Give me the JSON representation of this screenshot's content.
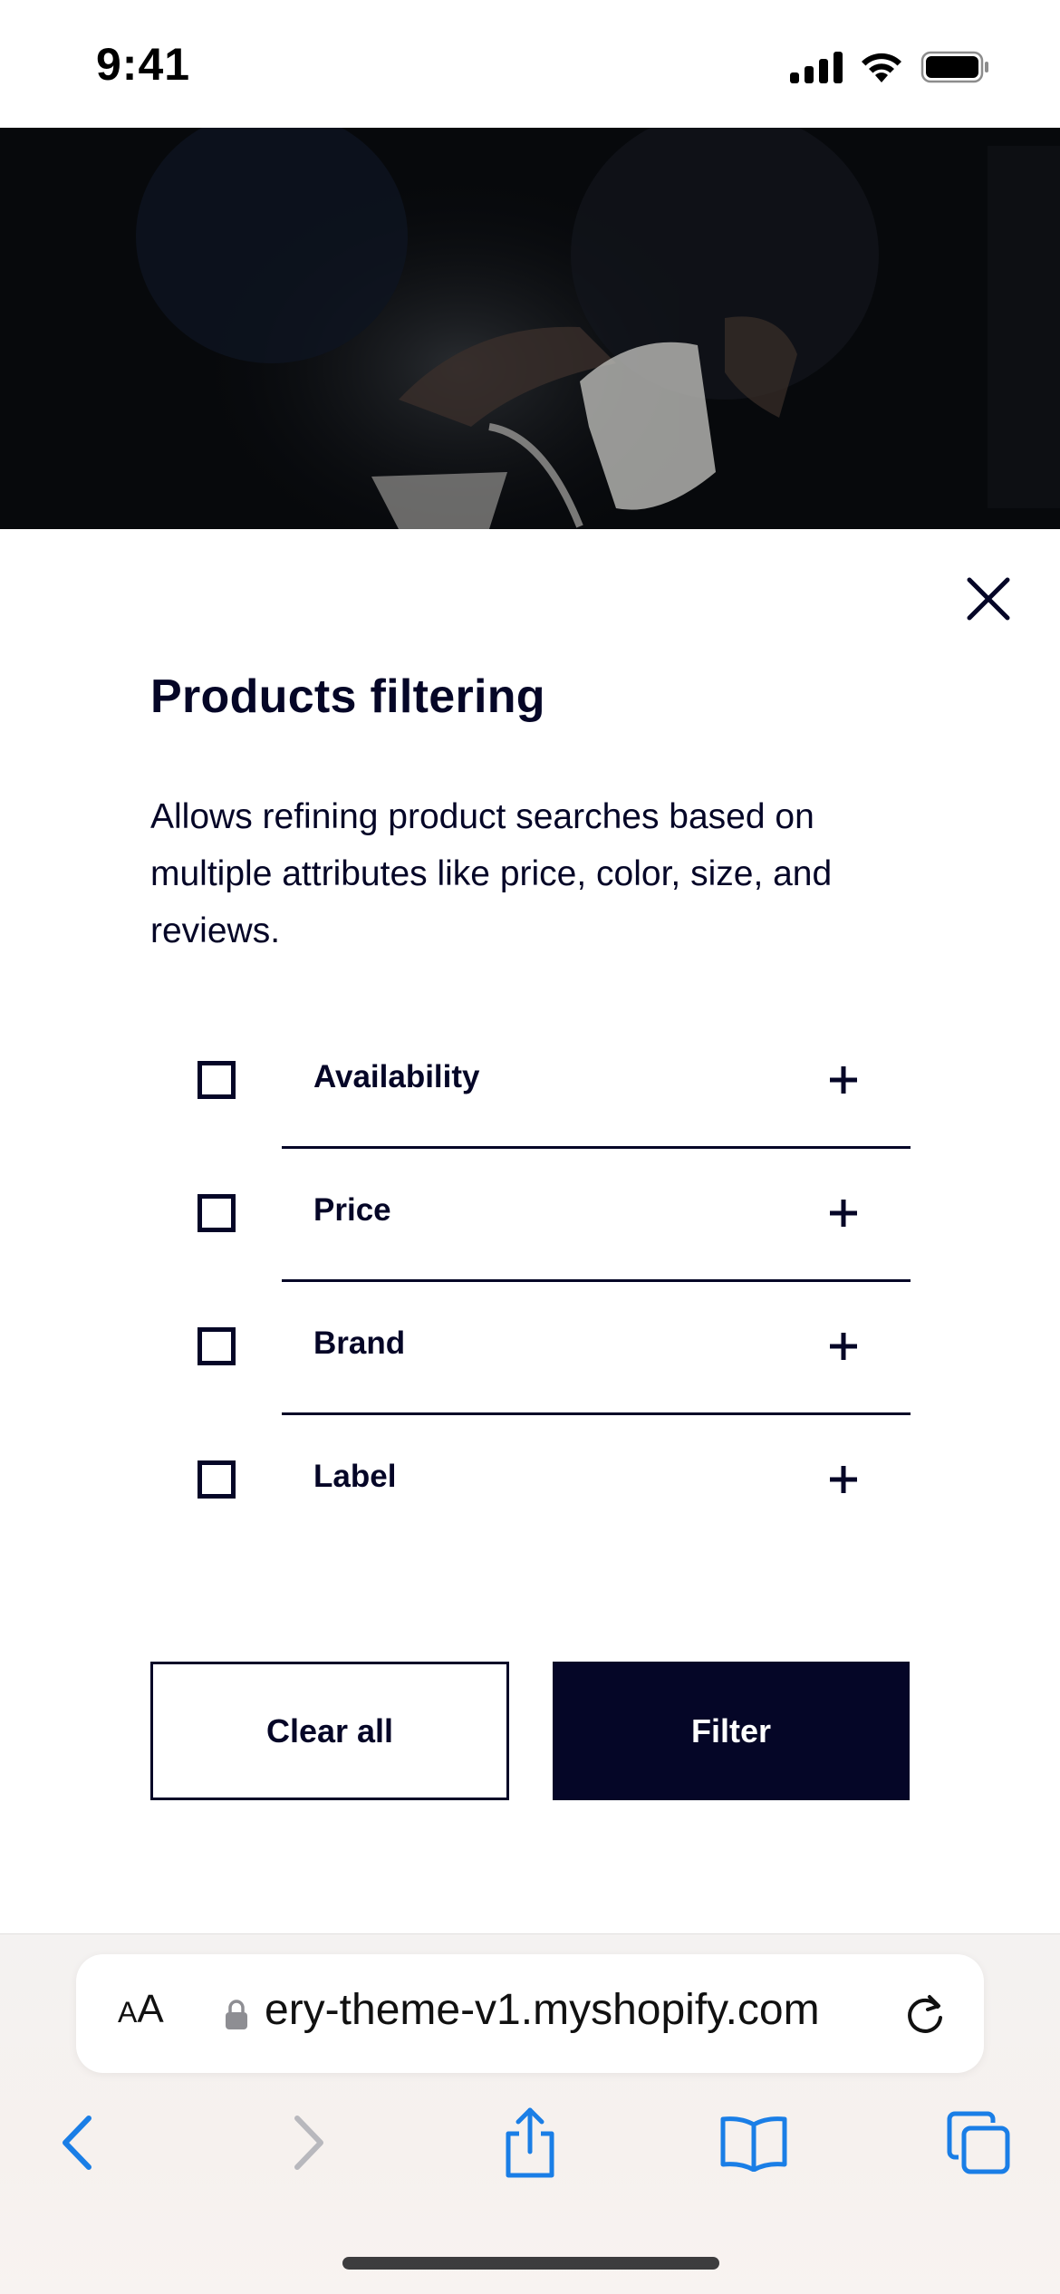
{
  "status_bar": {
    "time": "9:41",
    "icons": [
      "cellular-signal-icon",
      "wifi-icon",
      "battery-icon"
    ]
  },
  "hero": {
    "description_icon": "hero-image"
  },
  "modal": {
    "title": "Products filtering",
    "description": "Allows refining product searches based on multiple attributes like price, color, size, and reviews.",
    "close_icon": "close-icon",
    "filters": [
      {
        "label": "Availability",
        "checked": false
      },
      {
        "label": "Price",
        "checked": false
      },
      {
        "label": "Brand",
        "checked": false
      },
      {
        "label": "Label",
        "checked": false
      }
    ],
    "clear_label": "Clear all",
    "filter_label": "Filter"
  },
  "browser": {
    "aa_label": "AA",
    "url": "ery-theme-v1.myshopify.com",
    "toolbar": [
      "back-icon",
      "forward-icon",
      "share-icon",
      "bookmarks-icon",
      "tabs-icon"
    ]
  },
  "colors": {
    "primary": "#050627",
    "background": "#ffffff",
    "safari_blue": "#1a7ee6",
    "disabled_gray": "#b8b8bd"
  }
}
